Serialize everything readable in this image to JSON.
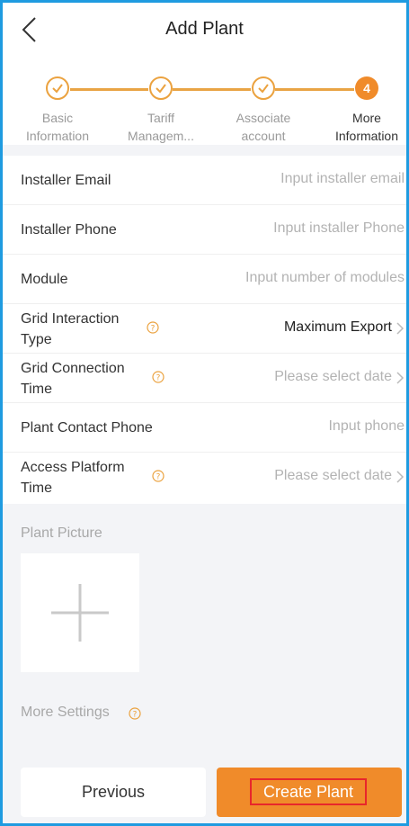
{
  "header": {
    "title": "Add Plant",
    "back_icon": "chevron-left-icon"
  },
  "stepper": {
    "accent": "#f08b2a",
    "steps": [
      {
        "label": "Basic\nInformation",
        "state": "done",
        "icon": "check-icon"
      },
      {
        "label": "Tariff\nManagem...",
        "state": "done",
        "icon": "check-icon"
      },
      {
        "label": "Associate\naccount",
        "state": "done",
        "icon": "check-icon"
      },
      {
        "label": "More\nInformation",
        "state": "active",
        "number": "4"
      }
    ]
  },
  "form": {
    "rows": [
      {
        "label": "Installer Email",
        "placeholder": "Input installer email"
      },
      {
        "label": "Installer Phone",
        "placeholder": "Input installer Phone"
      },
      {
        "label": "Module",
        "placeholder": "Input number of modules"
      },
      {
        "label": "Grid Interaction Type",
        "value": "Maximum Export"
      },
      {
        "label": "Grid Connection Time",
        "placeholder": "Please select date"
      },
      {
        "label": "Plant Contact Phone",
        "placeholder": "Input phone"
      },
      {
        "label": "Access Platform Time",
        "placeholder": "Please select date"
      }
    ]
  },
  "picture": {
    "label": "Plant Picture",
    "add_icon": "plus-icon"
  },
  "more_settings": {
    "label": "More Settings",
    "help_icon": "question-circle-icon"
  },
  "footer": {
    "previous_label": "Previous",
    "create_label": "Create Plant"
  },
  "colors": {
    "accent": "#f08b2a",
    "highlight_border": "#e8262b",
    "frame": "#1f9be0"
  }
}
